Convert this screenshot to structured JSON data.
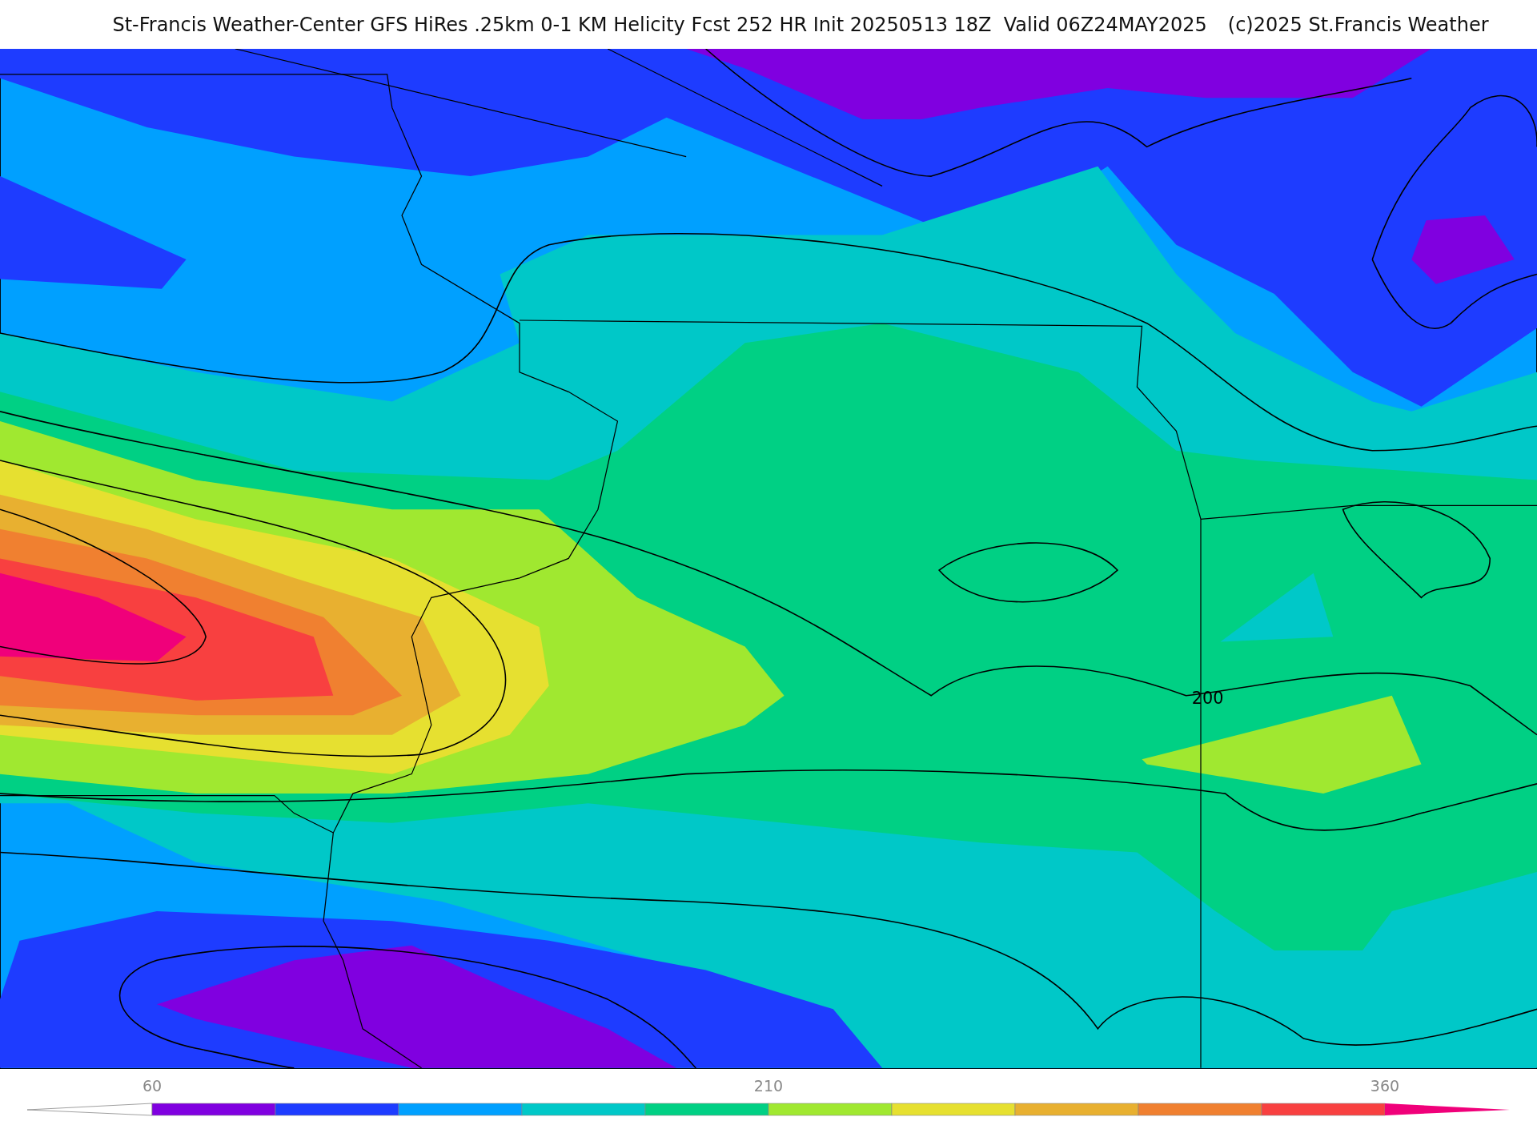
{
  "title": "St-Francis Weather-Center GFS HiRes .25km 0-1 KM Helicity Fcst 252 HR Init 20250513 18Z  Valid 06Z24MAY2025",
  "copyright": "(c)2025 St.Francis Weather",
  "map": {
    "contour_label": "200"
  },
  "colorbar": {
    "ticks": [
      "60",
      "210",
      "360"
    ],
    "segments": [
      {
        "color": "#8000e0"
      },
      {
        "color": "#1e3cff"
      },
      {
        "color": "#00a0ff"
      },
      {
        "color": "#00c8c8"
      },
      {
        "color": "#00d084"
      },
      {
        "color": "#a0e830"
      },
      {
        "color": "#e6e030"
      },
      {
        "color": "#e8b030"
      },
      {
        "color": "#f08030"
      },
      {
        "color": "#f84040"
      }
    ]
  }
}
